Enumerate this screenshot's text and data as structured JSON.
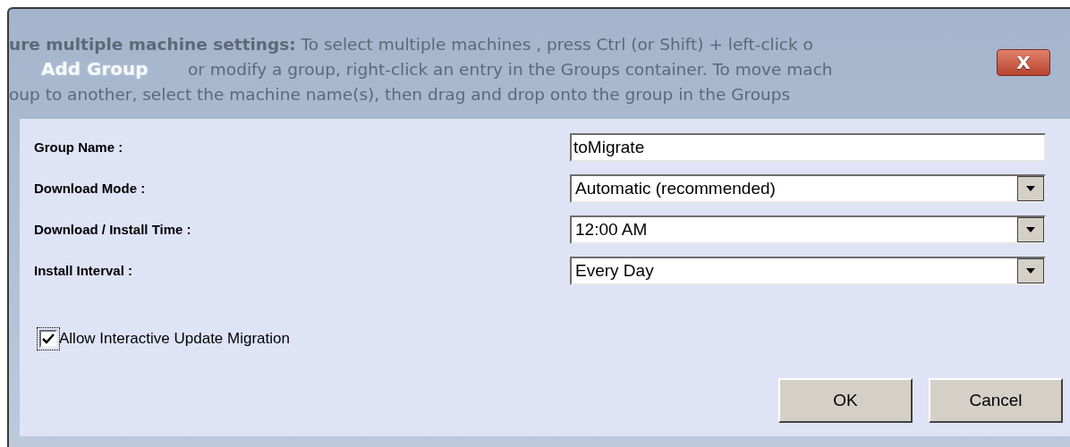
{
  "background_text": [
    "**ure multiple machine settings:** To select multiple machines , press Ctrl (or Shift) + left-click o",
    "or modify a group, right-click an entry in the Groups container. To move mach",
    "oup to another, select the machine name(s), then drag and drop onto the group in the Groups"
  ],
  "dialog": {
    "title": "Add Group",
    "close_label": "X",
    "fields": [
      {
        "kind": "text",
        "label": "Group Name :",
        "value": "toMigrate"
      },
      {
        "kind": "select",
        "label": "Download Mode :",
        "value": "Automatic (recommended)"
      },
      {
        "kind": "select",
        "label": "Download / Install Time :",
        "value": "12:00 AM"
      },
      {
        "kind": "select",
        "label": "Install Interval :",
        "value": "Every Day"
      }
    ],
    "checkbox": {
      "label": "Allow Interactive Update Migration",
      "checked": true
    },
    "buttons": [
      "OK",
      "Cancel"
    ]
  }
}
